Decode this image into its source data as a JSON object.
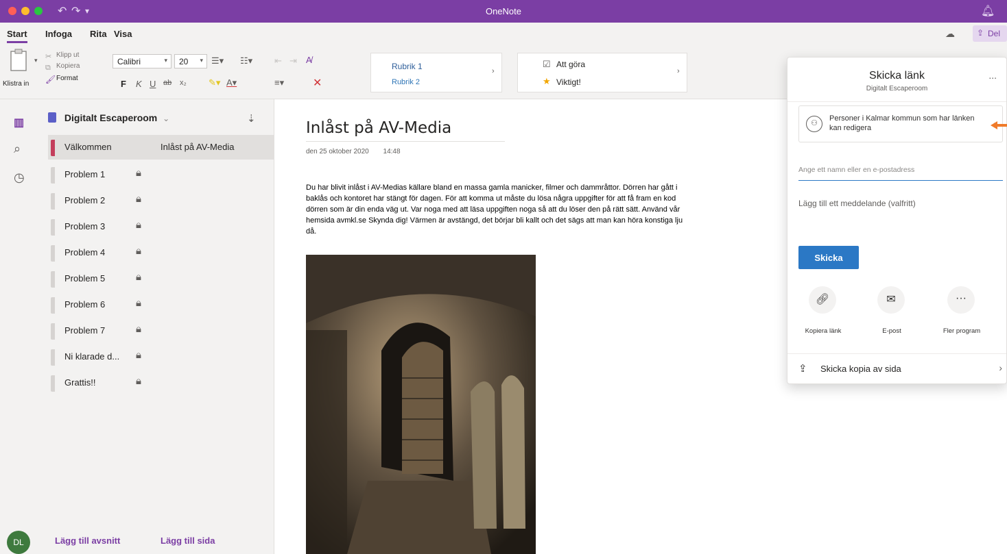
{
  "titlebar": {
    "title": "OneNote",
    "undo_icon": "undo-icon",
    "redo_icon": "redo-icon",
    "bell_icon": "bell-icon"
  },
  "menu": {
    "tabs": [
      "Start",
      "Infoga",
      "Rita",
      "Visa"
    ],
    "active": "Start",
    "share_label": "Del"
  },
  "ribbon": {
    "paste_label": "Klistra in",
    "cut_label": "Klipp ut",
    "copy_label": "Kopiera",
    "format_label": "Format",
    "font_name": "Calibri",
    "font_size": "20",
    "bold": "F",
    "italic": "K",
    "underline": "U",
    "strike": "ab",
    "subscript": "x₂",
    "style1": "Rubrik 1",
    "style2": "Rubrik 2",
    "tag1": "Att göra",
    "tag2": "Viktigt!"
  },
  "notebook": {
    "name": "Digitalt Escaperoom",
    "sections": [
      {
        "label": "Välkommen",
        "color": "#c43e5c",
        "locked": false
      },
      {
        "label": "Problem 1",
        "locked": true
      },
      {
        "label": "Problem 2",
        "locked": true
      },
      {
        "label": "Problem 3",
        "locked": true
      },
      {
        "label": "Problem 4",
        "locked": true
      },
      {
        "label": "Problem 5",
        "locked": true
      },
      {
        "label": "Problem 6",
        "locked": true
      },
      {
        "label": "Problem 7",
        "locked": true
      },
      {
        "label": "Ni klarade d...",
        "locked": true
      },
      {
        "label": "Grattis!!",
        "locked": true
      }
    ],
    "add_section": "Lägg till avsnitt",
    "add_page": "Lägg till sida",
    "pages": [
      "Inlåst på AV-Media"
    ],
    "avatar": "DL"
  },
  "page": {
    "title": "Inlåst på AV-Media",
    "date": "den 25 oktober 2020",
    "time": "14:48",
    "body_lines": [
      "Du har blivit inlåst i AV-Medias källare bland en massa gamla manicker, filmer och dammråttor. Dörren har gått i",
      "baklås och kontoret har stängt för dagen. För att komma ut måste du lösa några uppgifter för att få fram en kod",
      "dörren som är din enda väg ut. Var noga med att läsa uppgiften noga så att du löser den på rätt sätt. Använd vår",
      "hemsida avmkl.se  Skynda dig! Värmen är avstängd, det börjar bli kallt och det sägs att man kan höra konstiga lju",
      "då."
    ]
  },
  "share_panel": {
    "title": "Skicka länk",
    "subtitle": "Digitalt Escaperoom",
    "more": "...",
    "permission": "Personer i Kalmar kommun som har länken kan redigera",
    "recipient_placeholder": "Ange ett namn eller en e-postadress",
    "message_placeholder": "Lägg till ett meddelande (valfritt)",
    "send_label": "Skicka",
    "options": [
      "Kopiera länk",
      "E-post",
      "Fler program"
    ],
    "send_copy": "Skicka kopia av sida",
    "accent": "#2b78c5"
  }
}
